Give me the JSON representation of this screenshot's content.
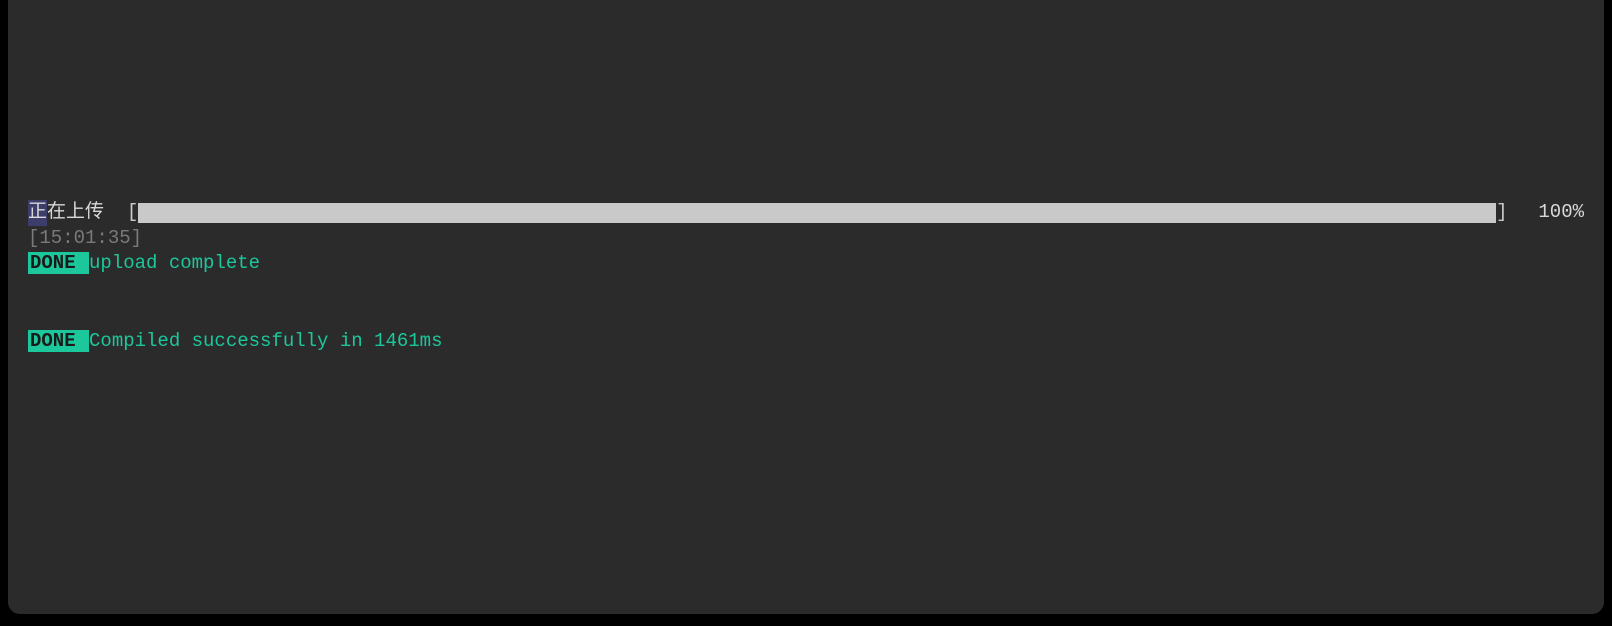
{
  "upload": {
    "label_first_char": "正",
    "label_rest": "在上传 ",
    "bracket_open": " [",
    "bracket_close": "] ",
    "percent": " 100%",
    "progress_value": 100
  },
  "timestamp": {
    "open": "[",
    "time": "15:01:35",
    "close": "]"
  },
  "status1": {
    "badge": " DONE ",
    "message": " upload complete"
  },
  "status2": {
    "badge": " DONE ",
    "message": " Compiled successfully in 1461ms"
  }
}
